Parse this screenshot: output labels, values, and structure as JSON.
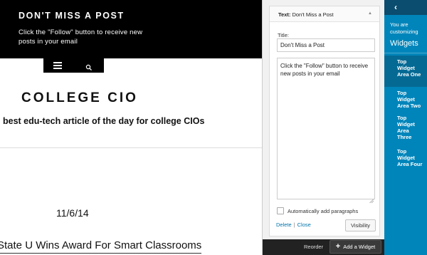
{
  "site": {
    "banner_title": "DON'T MISS A POST",
    "banner_text": "Click the \"Follow\" button to receive new posts in your email",
    "title": "COLLEGE CIO",
    "tagline": "best edu-tech article of the day for college CIOs",
    "post_date": "11/6/14",
    "post_title": "State U Wins Award For Smart Classrooms"
  },
  "widget": {
    "header_prefix": "Text:",
    "header_title": "Don't Miss a Post",
    "title_label": "Title:",
    "title_value": "Don't Miss a Post",
    "text_value": "Click the \"Follow\" button to receive new posts in your email",
    "auto_paragraphs_label": "Automatically add paragraphs",
    "auto_paragraphs_checked": false,
    "delete_label": "Delete",
    "separator": "|",
    "close_label": "Close",
    "visibility_label": "Visibility"
  },
  "footer": {
    "reorder_label": "Reorder",
    "add_widget_label": "Add a Widget"
  },
  "customizer": {
    "customizing_line1": "You are",
    "customizing_line2": "customizing",
    "section_title": "Widgets",
    "areas": [
      {
        "line1": "Top",
        "line2": "Widget",
        "line3": "Area One",
        "line4": ""
      },
      {
        "line1": "Top",
        "line2": "Widget",
        "line3": "Area Two",
        "line4": ""
      },
      {
        "line1": "Top",
        "line2": "Widget",
        "line3": "Area",
        "line4": "Three"
      },
      {
        "line1": "Top",
        "line2": "Widget",
        "line3": "Area Four",
        "line4": ""
      }
    ]
  },
  "colors": {
    "customizer_blue": "#0085ba",
    "active_area": "#046a94",
    "back_button": "#0b4d6e",
    "link_blue": "#0073aa"
  }
}
